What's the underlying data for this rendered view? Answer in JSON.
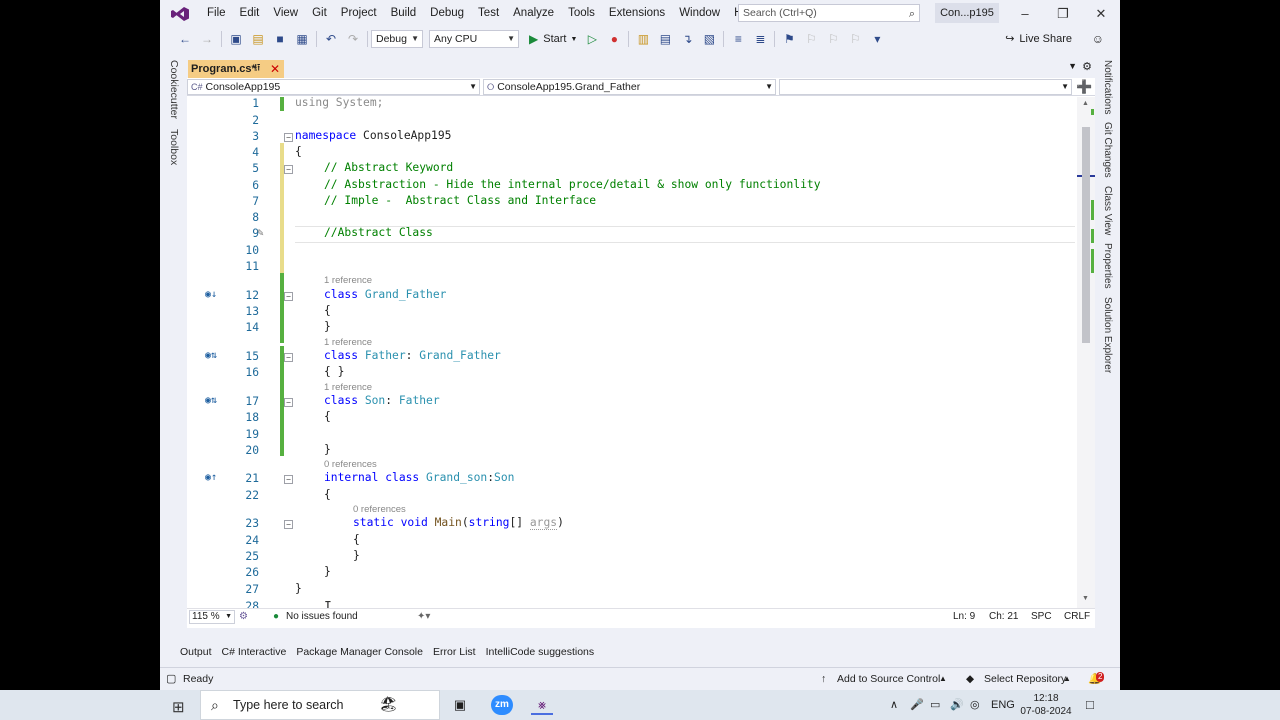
{
  "menu": [
    "File",
    "Edit",
    "View",
    "Git",
    "Project",
    "Build",
    "Debug",
    "Test",
    "Analyze",
    "Tools",
    "Extensions",
    "Window",
    "Help"
  ],
  "search": {
    "placeholder": "Search (Ctrl+Q)"
  },
  "solution_name": "Con...p195",
  "toolbar": {
    "config": "Debug",
    "platform": "Any CPU",
    "start_label": "Start",
    "live_share": "Live Share"
  },
  "left_rail": [
    "Cookiecutter",
    "Toolbox"
  ],
  "right_rail": [
    "Notifications",
    "Git Changes",
    "Class View",
    "Properties",
    "Solution Explorer"
  ],
  "tab": {
    "label": "Program.cs*"
  },
  "navbar": {
    "project": "ConsoleApp195",
    "type": "ConsoleApp195.Grand_Father",
    "member": ""
  },
  "code": {
    "line_numbers": [
      "1",
      "2",
      "3",
      "4",
      "5",
      "6",
      "7",
      "8",
      "9",
      "10",
      "11",
      "12",
      "13",
      "14",
      "15",
      "16",
      "17",
      "18",
      "19",
      "20",
      "21",
      "22",
      "23",
      "24",
      "25",
      "26",
      "27",
      "28"
    ],
    "l1": "using System;",
    "l3_kw": "namespace",
    "l3_name": " ConsoleApp195",
    "l4": "{",
    "l5": "// Abstract Keyword",
    "l6": "// Asbstraction - Hide the internal proce/detail & show only functionlity",
    "l7": "// Imple -  Abstract Class and Interface",
    "l9": "//Abstract Class",
    "ref12": "1 reference",
    "l12_kw": "class",
    "l12_ty": " Grand_Father",
    "l13": "{",
    "l14": "}",
    "ref15": "1 reference",
    "l15_kw": "class",
    "l15_ty": " Father",
    "l15_base": "Grand_Father",
    "l16": "{ }",
    "ref17": "1 reference",
    "l17_kw": "class",
    "l17_ty": " Son",
    "l17_base": "Father",
    "l18": "{",
    "l20": "}",
    "ref21": "0 references",
    "l21_kw": "internal class",
    "l21_ty": " Grand_son",
    "l21_base": "Son",
    "l22": "{",
    "ref23": "0 references",
    "l23_kw": "static void",
    "l23_mt": " Main",
    "l23_p1": "(",
    "l23_ty": "string",
    "l23_p2": "[] ",
    "l23_arg": "args",
    "l23_p3": ")",
    "l24": "{",
    "l25": "}",
    "l26": "}",
    "l27": "}"
  },
  "editor_status": {
    "zoom": "115 %",
    "issues": "No issues found",
    "ln": "Ln: 9",
    "ch": "Ch: 21",
    "spc": "SPC",
    "crlf": "CRLF"
  },
  "bottom_tabs": [
    "Output",
    "C# Interactive",
    "Package Manager Console",
    "Error List",
    "IntelliCode suggestions"
  ],
  "statusbar": {
    "ready": "Ready",
    "source_control": "Add to Source Control",
    "repo": "Select Repository",
    "notif_count": "2"
  },
  "taskbar": {
    "search_placeholder": "Type here to search",
    "lang": "ENG",
    "time": "12:18",
    "date": "07-08-2024"
  },
  "colors": {
    "accent": "#68217a",
    "tab": "#f5cc84",
    "keyword": "#0000ff",
    "comment": "#008000",
    "type": "#2b91af",
    "change_bar": "#56b040"
  }
}
